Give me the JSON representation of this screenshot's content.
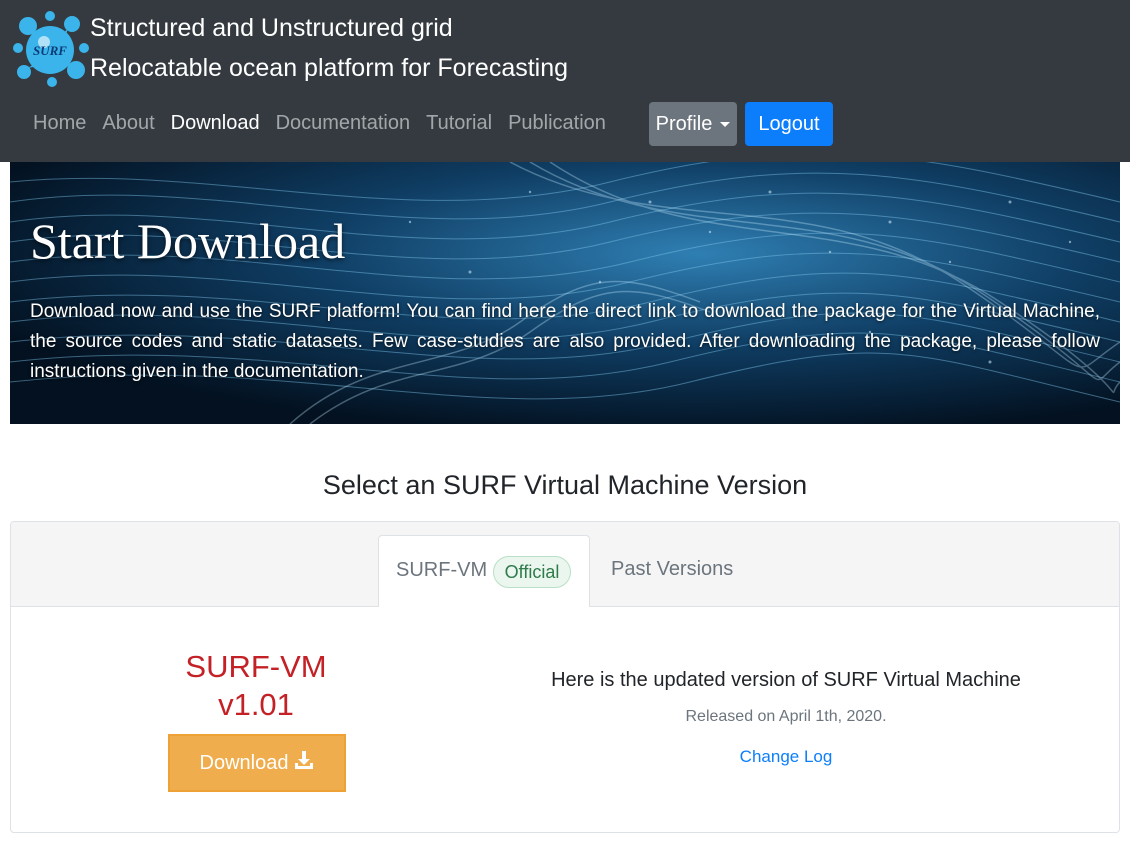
{
  "header": {
    "brand_line1": "Structured and Unstructured grid",
    "brand_line2": "Relocatable ocean platform for Forecasting",
    "logo_text": "SURF",
    "nav": [
      {
        "label": "Home"
      },
      {
        "label": "About"
      },
      {
        "label": "Download"
      },
      {
        "label": "Documentation"
      },
      {
        "label": "Tutorial"
      },
      {
        "label": "Publication"
      }
    ],
    "active_nav": "Download",
    "profile_label": "Profile",
    "logout_label": "Logout"
  },
  "hero": {
    "title": "Start Download",
    "text": "Download now and use the SURF platform! You can find here the direct link to download the package for the Virtual Machine, the source codes and static datasets. Few case-studies are also provided. After downloading the package, please follow instructions given in the documentation."
  },
  "section": {
    "title": "Select an SURF Virtual Machine Version"
  },
  "tabs": {
    "active_label": "SURF-VM",
    "active_badge": "Official",
    "past_label": "Past Versions"
  },
  "release": {
    "name_line1": "SURF-VM",
    "name_line2": "v1.01",
    "download_label": "Download",
    "description": "Here is the updated version of SURF Virtual Machine",
    "released": "Released on April 1th, 2020.",
    "changelog_label": "Change Log"
  },
  "colors": {
    "navbar": "#343a40",
    "primary": "#0d7efb",
    "secondary": "#6c757d",
    "version_red": "#c42127",
    "download_orange": "#f0ad4e"
  },
  "icons": {
    "logo": "surf-splash-logo",
    "caret": "caret-down-icon",
    "download": "download-icon"
  }
}
